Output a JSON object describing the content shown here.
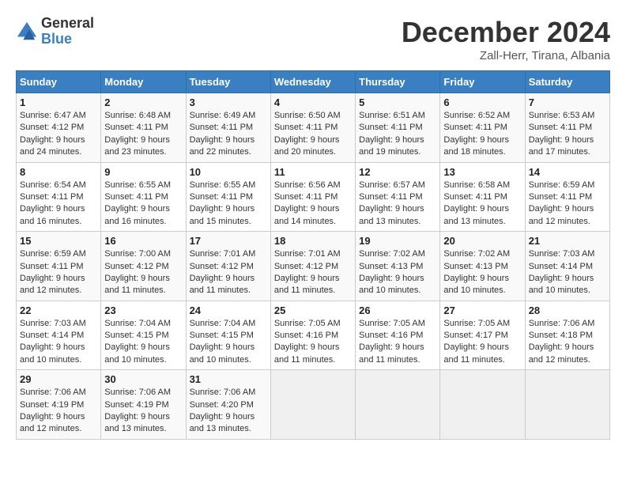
{
  "logo": {
    "line1": "General",
    "line2": "Blue"
  },
  "title": "December 2024",
  "subtitle": "Zall-Herr, Tirana, Albania",
  "days_of_week": [
    "Sunday",
    "Monday",
    "Tuesday",
    "Wednesday",
    "Thursday",
    "Friday",
    "Saturday"
  ],
  "weeks": [
    [
      {
        "num": "1",
        "sunrise": "6:47 AM",
        "sunset": "4:12 PM",
        "daylight": "9 hours and 24 minutes."
      },
      {
        "num": "2",
        "sunrise": "6:48 AM",
        "sunset": "4:11 PM",
        "daylight": "9 hours and 23 minutes."
      },
      {
        "num": "3",
        "sunrise": "6:49 AM",
        "sunset": "4:11 PM",
        "daylight": "9 hours and 22 minutes."
      },
      {
        "num": "4",
        "sunrise": "6:50 AM",
        "sunset": "4:11 PM",
        "daylight": "9 hours and 20 minutes."
      },
      {
        "num": "5",
        "sunrise": "6:51 AM",
        "sunset": "4:11 PM",
        "daylight": "9 hours and 19 minutes."
      },
      {
        "num": "6",
        "sunrise": "6:52 AM",
        "sunset": "4:11 PM",
        "daylight": "9 hours and 18 minutes."
      },
      {
        "num": "7",
        "sunrise": "6:53 AM",
        "sunset": "4:11 PM",
        "daylight": "9 hours and 17 minutes."
      }
    ],
    [
      {
        "num": "8",
        "sunrise": "6:54 AM",
        "sunset": "4:11 PM",
        "daylight": "9 hours and 16 minutes."
      },
      {
        "num": "9",
        "sunrise": "6:55 AM",
        "sunset": "4:11 PM",
        "daylight": "9 hours and 16 minutes."
      },
      {
        "num": "10",
        "sunrise": "6:55 AM",
        "sunset": "4:11 PM",
        "daylight": "9 hours and 15 minutes."
      },
      {
        "num": "11",
        "sunrise": "6:56 AM",
        "sunset": "4:11 PM",
        "daylight": "9 hours and 14 minutes."
      },
      {
        "num": "12",
        "sunrise": "6:57 AM",
        "sunset": "4:11 PM",
        "daylight": "9 hours and 13 minutes."
      },
      {
        "num": "13",
        "sunrise": "6:58 AM",
        "sunset": "4:11 PM",
        "daylight": "9 hours and 13 minutes."
      },
      {
        "num": "14",
        "sunrise": "6:59 AM",
        "sunset": "4:11 PM",
        "daylight": "9 hours and 12 minutes."
      }
    ],
    [
      {
        "num": "15",
        "sunrise": "6:59 AM",
        "sunset": "4:11 PM",
        "daylight": "9 hours and 12 minutes."
      },
      {
        "num": "16",
        "sunrise": "7:00 AM",
        "sunset": "4:12 PM",
        "daylight": "9 hours and 11 minutes."
      },
      {
        "num": "17",
        "sunrise": "7:01 AM",
        "sunset": "4:12 PM",
        "daylight": "9 hours and 11 minutes."
      },
      {
        "num": "18",
        "sunrise": "7:01 AM",
        "sunset": "4:12 PM",
        "daylight": "9 hours and 11 minutes."
      },
      {
        "num": "19",
        "sunrise": "7:02 AM",
        "sunset": "4:13 PM",
        "daylight": "9 hours and 10 minutes."
      },
      {
        "num": "20",
        "sunrise": "7:02 AM",
        "sunset": "4:13 PM",
        "daylight": "9 hours and 10 minutes."
      },
      {
        "num": "21",
        "sunrise": "7:03 AM",
        "sunset": "4:14 PM",
        "daylight": "9 hours and 10 minutes."
      }
    ],
    [
      {
        "num": "22",
        "sunrise": "7:03 AM",
        "sunset": "4:14 PM",
        "daylight": "9 hours and 10 minutes."
      },
      {
        "num": "23",
        "sunrise": "7:04 AM",
        "sunset": "4:15 PM",
        "daylight": "9 hours and 10 minutes."
      },
      {
        "num": "24",
        "sunrise": "7:04 AM",
        "sunset": "4:15 PM",
        "daylight": "9 hours and 10 minutes."
      },
      {
        "num": "25",
        "sunrise": "7:05 AM",
        "sunset": "4:16 PM",
        "daylight": "9 hours and 11 minutes."
      },
      {
        "num": "26",
        "sunrise": "7:05 AM",
        "sunset": "4:16 PM",
        "daylight": "9 hours and 11 minutes."
      },
      {
        "num": "27",
        "sunrise": "7:05 AM",
        "sunset": "4:17 PM",
        "daylight": "9 hours and 11 minutes."
      },
      {
        "num": "28",
        "sunrise": "7:06 AM",
        "sunset": "4:18 PM",
        "daylight": "9 hours and 12 minutes."
      }
    ],
    [
      {
        "num": "29",
        "sunrise": "7:06 AM",
        "sunset": "4:19 PM",
        "daylight": "9 hours and 12 minutes."
      },
      {
        "num": "30",
        "sunrise": "7:06 AM",
        "sunset": "4:19 PM",
        "daylight": "9 hours and 13 minutes."
      },
      {
        "num": "31",
        "sunrise": "7:06 AM",
        "sunset": "4:20 PM",
        "daylight": "9 hours and 13 minutes."
      },
      null,
      null,
      null,
      null
    ]
  ]
}
